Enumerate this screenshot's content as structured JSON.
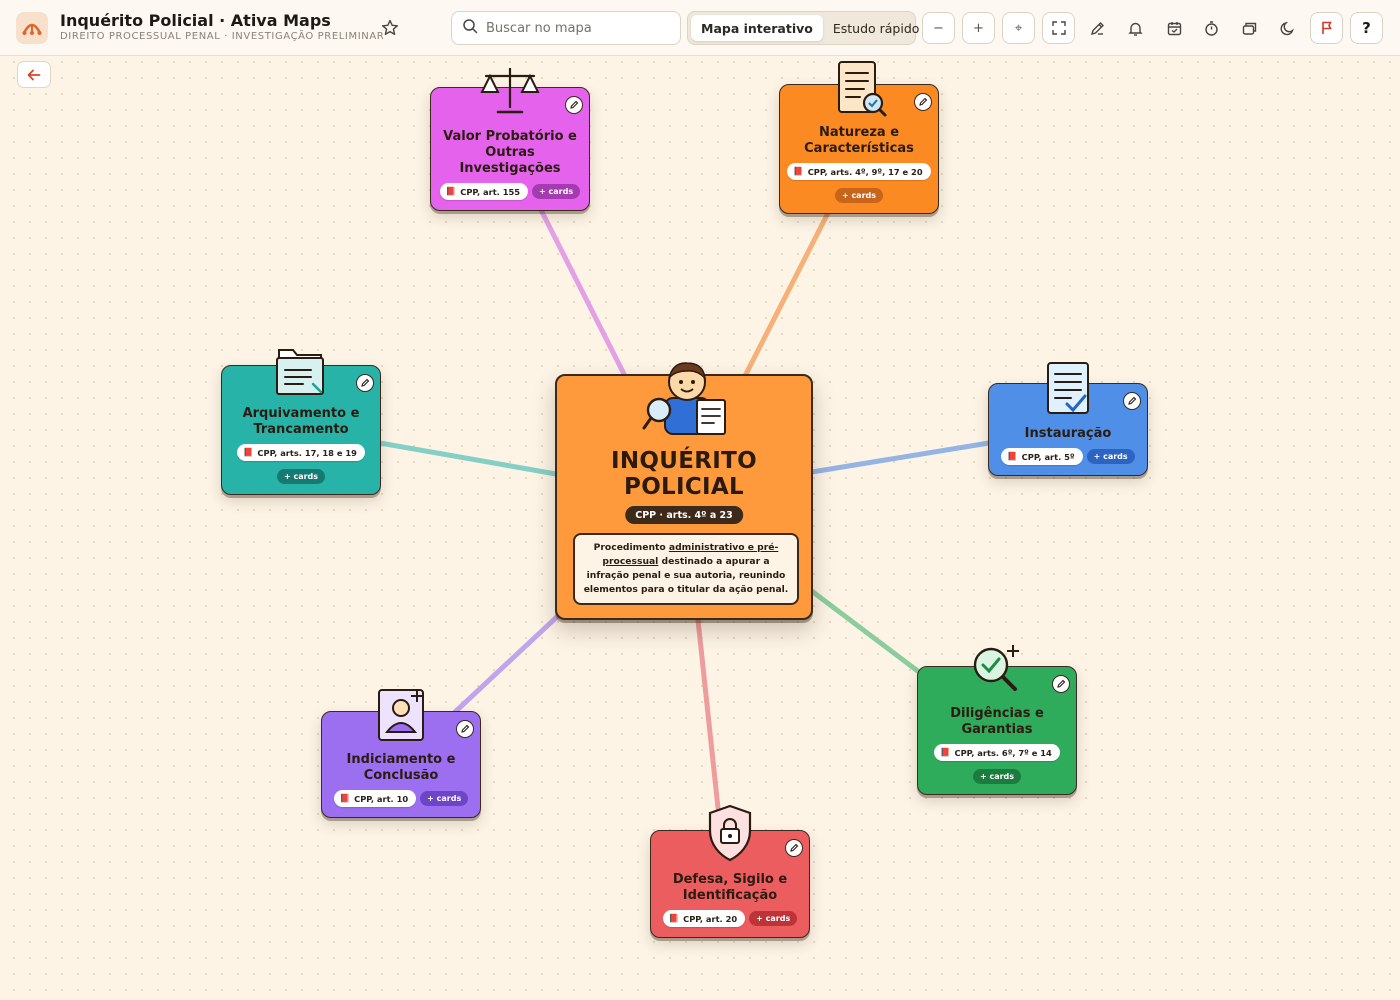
{
  "app": {
    "title": "Inquérito Policial · Ativa Maps",
    "subtitle": "DIREITO PROCESSUAL PENAL · INVESTIGAÇÃO PRELIMINAR",
    "logo_icon": "ativa-maps-logo"
  },
  "search": {
    "placeholder": "Buscar no mapa"
  },
  "mode_toggle": {
    "options": [
      "Mapa interativo",
      "Estudo rápido"
    ],
    "active": "Mapa interativo"
  },
  "toolbar": {
    "zoom_out": "−",
    "zoom_in": "+",
    "center": "⌖",
    "help": "?",
    "icons": [
      "zoom-out-icon",
      "zoom-in-icon",
      "center-icon",
      "fullscreen-icon",
      "pen-icon",
      "bell-icon",
      "calendar-icon",
      "timer-icon",
      "cards-icon",
      "moon-icon",
      "flag-icon",
      "help-icon"
    ]
  },
  "center_node": {
    "title": "INQUÉRITO POLICIAL",
    "title_line1": "INQUÉRITO",
    "title_line2": "POLICIAL",
    "badge": "CPP · arts. 4º a 23",
    "description_prefix": "Procedimento ",
    "description_link": "administrativo e pré-processual",
    "description_suffix": " destinado a apurar a infração penal e sua autoria, reunindo elementos para o titular da ação penal.",
    "color": "#ff9a3c"
  },
  "nodes": [
    {
      "id": "valor",
      "title": "Valor Probatório e Outras Investigações",
      "law": "CPP, art. 155",
      "cards": "+ cards",
      "icon": "scales-icon",
      "color": "#e562ec",
      "edge": "#e3a0e6"
    },
    {
      "id": "natureza",
      "title": "Natureza e Características",
      "law": "CPP, arts. 4º, 9º, 17 e 20",
      "cards": "+ cards",
      "icon": "document-search-icon",
      "color": "#fb8a22",
      "edge": "#f6b07a"
    },
    {
      "id": "arquivamento",
      "title": "Arquivamento e Trancamento",
      "law": "CPP, arts. 17, 18 e 19",
      "cards": "+ cards",
      "icon": "folder-icon",
      "color": "#27b3a8",
      "edge": "#86cfc6"
    },
    {
      "id": "instauracao",
      "title": "Instauração",
      "law": "CPP, art. 5º",
      "cards": "+ cards",
      "icon": "checklist-icon",
      "color": "#4f8fe8",
      "edge": "#94b4e4"
    },
    {
      "id": "indiciamento",
      "title": "Indiciamento e Conclusão",
      "law": "CPP, art. 10",
      "cards": "+ cards",
      "icon": "person-add-icon",
      "color": "#9b6ff0",
      "edge": "#c1a5ec"
    },
    {
      "id": "diligencias",
      "title": "Diligências e Garantias",
      "law": "CPP, arts. 6º, 7º e 14",
      "cards": "+ cards",
      "icon": "magnifier-check-icon",
      "color": "#2eac5c",
      "edge": "#8ccc9e"
    },
    {
      "id": "defesa",
      "title": "Defesa, Sigilo e Identificação",
      "law": "CPP, art. 20",
      "cards": "+ cards",
      "icon": "shield-lock-icon",
      "color": "#ec5d60",
      "edge": "#ee9c9c"
    }
  ]
}
